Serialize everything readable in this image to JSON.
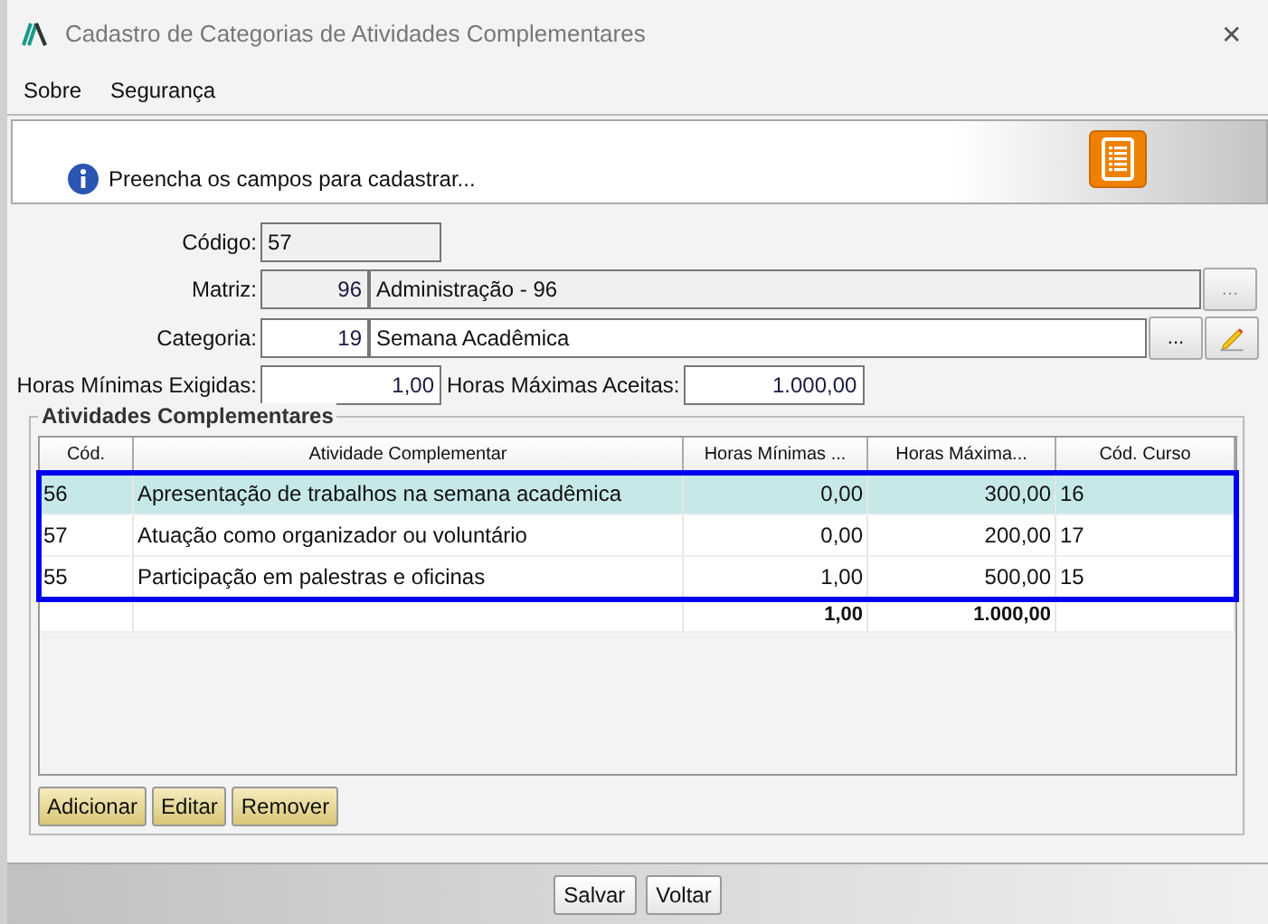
{
  "window": {
    "title": "Cadastro de Categorias de Atividades Complementares",
    "close": "✕"
  },
  "menu": [
    {
      "label": "Sobre"
    },
    {
      "label": "Segurança"
    }
  ],
  "header": {
    "message": "Preencha os campos para cadastrar..."
  },
  "form": {
    "codigo": {
      "label": "Código:",
      "value": "57",
      "readonly": true
    },
    "matriz": {
      "label": "Matriz:",
      "code": "96",
      "name": "Administração - 96",
      "readonly": true,
      "lookup_button": {
        "label": "...",
        "disabled": true
      }
    },
    "categoria": {
      "label": "Categoria:",
      "code": "19",
      "name": "Semana Acadêmica",
      "readonly": false,
      "lookup_button": {
        "label": "...",
        "disabled": false
      }
    },
    "horas_minimas": {
      "label": "Horas Mínimas Exigidas:",
      "value": "1,00"
    },
    "horas_maximas": {
      "label": "Horas Máximas Aceitas:",
      "value": "1.000,00"
    }
  },
  "group": {
    "title": "Atividades Complementares",
    "table": {
      "columns": [
        "Cód.",
        "Atividade Complementar",
        "Horas Mínimas ...",
        "Horas Máxima...",
        "Cód. Curso"
      ],
      "highlighted": true,
      "rows": [
        {
          "cells": [
            "56",
            "Apresentação de trabalhos na semana acadêmica",
            "0,00",
            "300,00",
            "16"
          ],
          "selected": true
        },
        {
          "cells": [
            "57",
            "Atuação como organizador ou voluntário",
            "0,00",
            "200,00",
            "17"
          ],
          "selected": false
        },
        {
          "cells": [
            "55",
            "Participação em palestras e oficinas",
            "1,00",
            "500,00",
            "15"
          ],
          "selected": false
        }
      ],
      "totals": {
        "horas_minimas": "1,00",
        "horas_maximas": "1.000,00"
      }
    },
    "buttons": [
      {
        "label": "Adicionar"
      },
      {
        "label": "Editar"
      },
      {
        "label": "Remover"
      }
    ]
  },
  "footer_buttons": [
    {
      "label": "Salvar"
    },
    {
      "label": "Voltar"
    }
  ]
}
